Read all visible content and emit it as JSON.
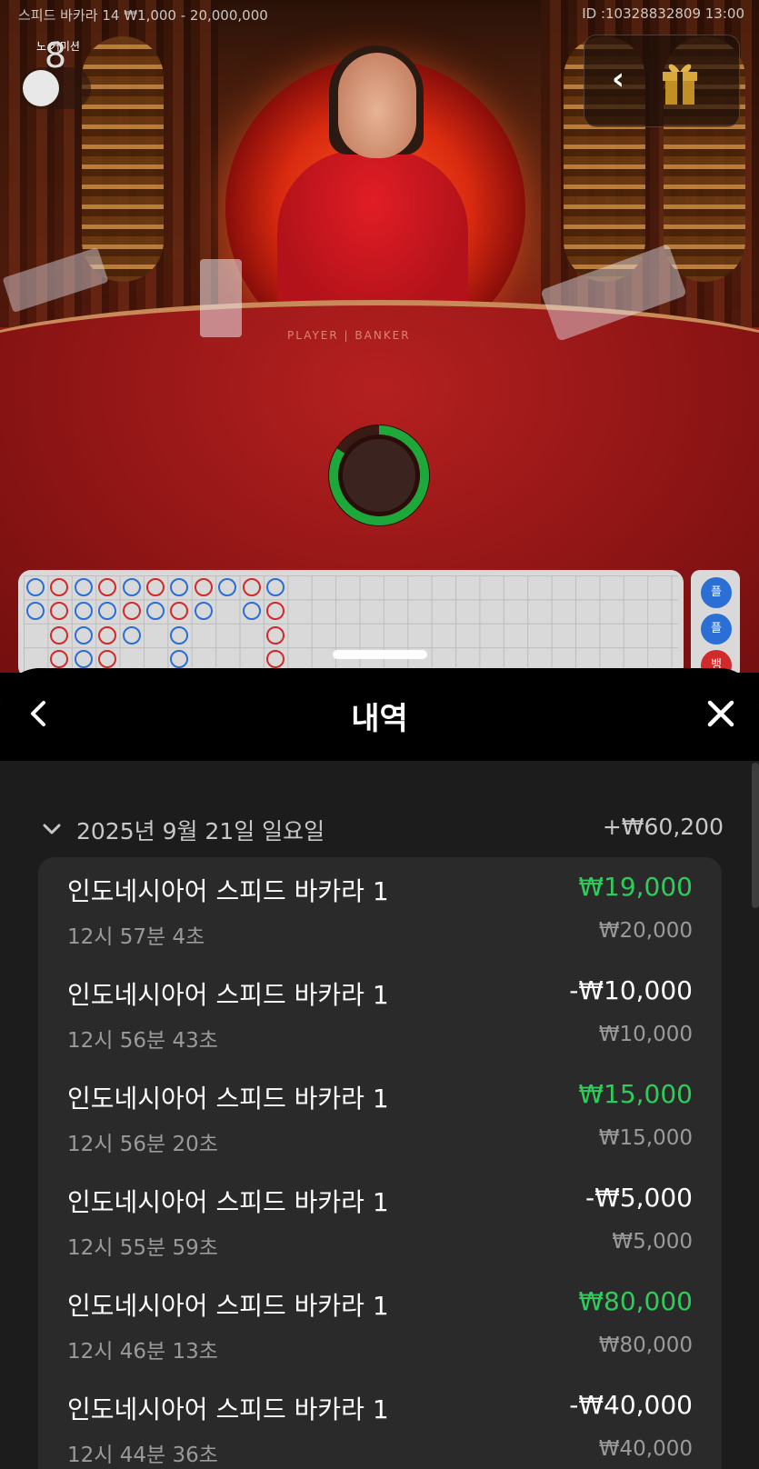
{
  "game_view": {
    "title": "스피드 바카라 14 ₩1,000 - 20,000,000",
    "id_time": "ID :10328832809 13:00",
    "no_commission_label": "노 커미션",
    "table_label": "PLAYER | BANKER",
    "timer_value": "8",
    "side_buttons": [
      "플",
      "플",
      "뱅"
    ],
    "roadmap": {
      "rows": [
        [
          "p",
          "b",
          "p",
          "b",
          "p",
          "b",
          "p",
          "b",
          "p",
          "b",
          "p"
        ],
        [
          "p",
          "b",
          "p",
          "p",
          "b",
          "p",
          "b",
          "p",
          "",
          "p",
          "b"
        ],
        [
          "",
          "b",
          "p",
          "b",
          "p",
          "",
          "p",
          "",
          "",
          "",
          "b"
        ],
        [
          "",
          "b",
          "p",
          "b",
          "",
          "",
          "p",
          "",
          "",
          "",
          "b"
        ]
      ]
    }
  },
  "history_sheet": {
    "title": "내역",
    "day": {
      "date_label": "2025년 9월 21일 일요일",
      "total": "+₩60,200"
    },
    "entries": [
      {
        "game": "인도네시아어 스피드 바카라 1",
        "time": "12시 57분 4초",
        "result": "₩19,000",
        "result_type": "win",
        "bet": "₩20,000"
      },
      {
        "game": "인도네시아어 스피드 바카라 1",
        "time": "12시 56분 43초",
        "result": "-₩10,000",
        "result_type": "loss",
        "bet": "₩10,000"
      },
      {
        "game": "인도네시아어 스피드 바카라 1",
        "time": "12시 56분 20초",
        "result": "₩15,000",
        "result_type": "win",
        "bet": "₩15,000"
      },
      {
        "game": "인도네시아어 스피드 바카라 1",
        "time": "12시 55분 59초",
        "result": "-₩5,000",
        "result_type": "loss",
        "bet": "₩5,000"
      },
      {
        "game": "인도네시아어 스피드 바카라 1",
        "time": "12시 46분 13초",
        "result": "₩80,000",
        "result_type": "win",
        "bet": "₩80,000"
      },
      {
        "game": "인도네시아어 스피드 바카라 1",
        "time": "12시 44분 36초",
        "result": "-₩40,000",
        "result_type": "loss",
        "bet": "₩40,000"
      }
    ]
  },
  "colors": {
    "win": "#2ecc5a",
    "loss": "#ffffff",
    "player": "#2b6fd6",
    "banker": "#d02a2a",
    "timer_ring": "#1fa83a"
  },
  "icons": {
    "back": "chevron-left-icon",
    "close": "close-icon",
    "gift": "gift-icon",
    "day_toggle": "chevron-down-icon"
  }
}
